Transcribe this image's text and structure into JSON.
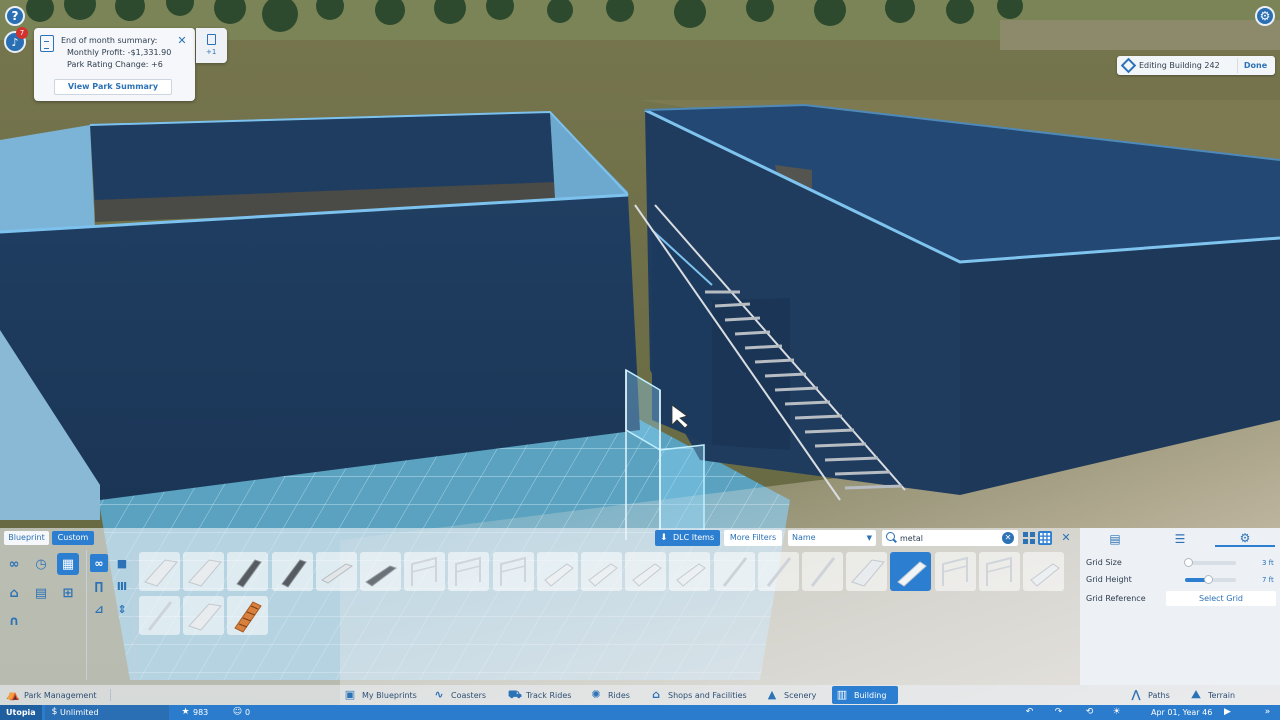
{
  "notification": {
    "badge_count": "7",
    "title": "End of month summary:",
    "monthly_profit": "Monthly Profit: -$1,331.90",
    "rating_change": "Park Rating Change: +6",
    "button_label": "View Park Summary",
    "secondary_count": "+1"
  },
  "help_label": "?",
  "editing": {
    "label": "Editing Building 242",
    "done_label": "Done"
  },
  "panel": {
    "mode_tabs": [
      "Blueprint",
      "Custom"
    ],
    "active_mode": "Custom",
    "filters": {
      "dlc_label": "DLC Items",
      "more_filters_label": "More Filters",
      "sort_value": "Name",
      "search_value": "metal"
    },
    "selected_tile_index": 17,
    "settings": {
      "grid_size_label": "Grid Size",
      "grid_size_value": "3 ft",
      "grid_size_level": 0.05,
      "grid_height_label": "Grid Height",
      "grid_height_value": "7 ft",
      "grid_height_level": 0.45,
      "grid_reference_label": "Grid Reference",
      "grid_reference_button": "Select Grid"
    }
  },
  "toolbar": {
    "park_management": "Park Management",
    "my_blueprints": "My Blueprints",
    "coasters": "Coasters",
    "track_rides": "Track Rides",
    "rides": "Rides",
    "shops": "Shops and Facilities",
    "scenery": "Scenery",
    "building": "Building",
    "paths": "Paths",
    "terrain": "Terrain"
  },
  "status": {
    "park_name": "Utopia",
    "money": "Unlimited",
    "rating": "983",
    "guests": "0",
    "date": "Apr 01, Year 46"
  },
  "colors": {
    "accent": "#2c7fd0",
    "wall": "#1f3f63",
    "sky_ground": "#6b6d47"
  }
}
